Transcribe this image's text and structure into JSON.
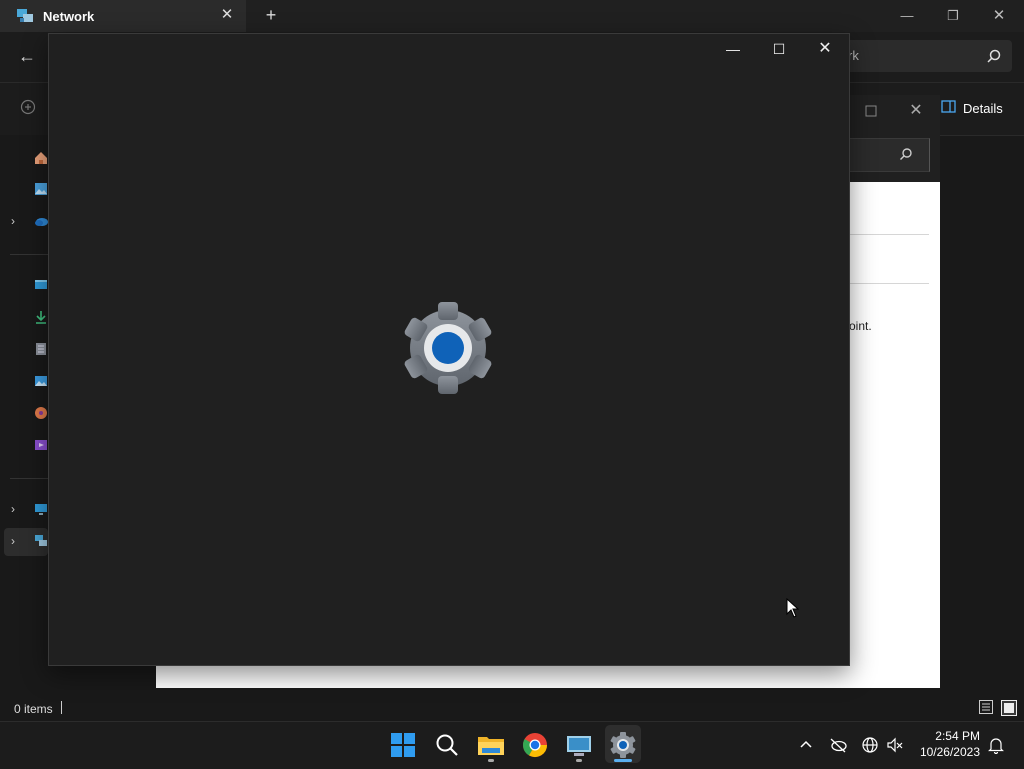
{
  "explorer": {
    "tab_title": "Network",
    "tab_close": "✕",
    "new_tab": "+",
    "minimize": "—",
    "restore": "❐",
    "close": "✕",
    "back": "←",
    "search_placeholder": "rk",
    "details_label": "Details",
    "status_items": "0 items"
  },
  "background_dialog": {
    "close": "✕",
    "partial_text": "oint."
  },
  "settings_splash": {
    "minimize": "—",
    "maximize": "☐",
    "close": "✕",
    "app_icon": "settings-gear-icon"
  },
  "taskbar": {
    "icons": [
      "windows-start-icon",
      "search-icon",
      "file-explorer-icon",
      "chrome-icon",
      "network-control-icon",
      "settings-icon"
    ],
    "clock_time": "2:54 PM",
    "clock_date": "10/26/2023"
  },
  "colors": {
    "accent": "#0f62b8",
    "taskbar_indicator": "#5aaff0"
  }
}
